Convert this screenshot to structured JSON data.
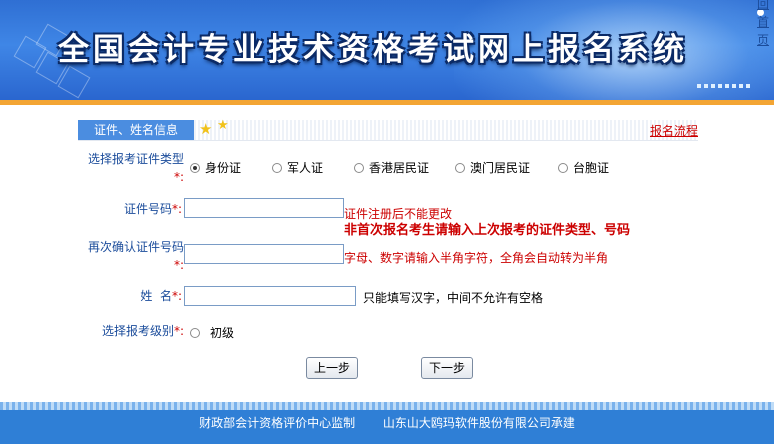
{
  "header": {
    "title": "全国会计专业技术资格考试网上报名系统",
    "back_home": "返回首页"
  },
  "section": {
    "tab_label": "证件、姓名信息",
    "flow_link": "报名流程"
  },
  "form": {
    "id_type_label": "选择报考证件类型",
    "id_types": [
      "身份证",
      "军人证",
      "香港居民证",
      "澳门居民证",
      "台胞证"
    ],
    "id_type_selected": "身份证",
    "id_number_label": "证件号码",
    "id_number_value": "",
    "id_note": "证件注册后不能更改",
    "id_warning": "非首次报名考生请输入上次报考的证件类型、号码",
    "confirm_label": "再次确认证件号码",
    "confirm_value": "",
    "confirm_note": "字母、数字请输入半角字符，全角会自动转为半角",
    "name_label": "姓  名",
    "name_value": "",
    "name_note": "只能填写汉字，中间不允许有空格",
    "level_label": "选择报考级别",
    "level_options": [
      "初级"
    ],
    "required_mark": "*:"
  },
  "buttons": {
    "prev": "上一步",
    "next": "下一步"
  },
  "footer": {
    "left": "财政部会计资格评价中心监制",
    "right": "山东山大鸥玛软件股份有限公司承建"
  },
  "colors": {
    "banner": "#3f86e6",
    "accent_orange": "#f3a534",
    "label_blue": "#1b4c9b",
    "warning_red": "#cc0000",
    "footer": "#2f7fd6"
  }
}
